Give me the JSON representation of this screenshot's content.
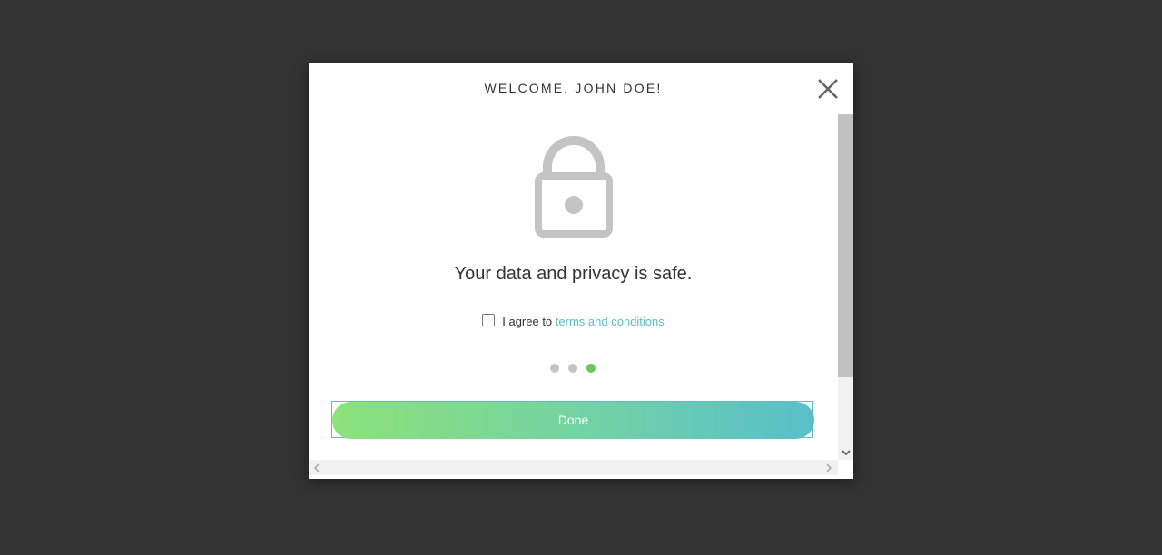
{
  "modal": {
    "title": "WELCOME, JOHN DOE!",
    "close_icon": "close-icon",
    "hero_icon": "lock-icon",
    "message": "Your data and privacy is safe.",
    "agreement": {
      "checked": false,
      "prefix": "I agree to",
      "link_text": "terms and conditions"
    },
    "pagination": {
      "total": 3,
      "active_index": 2
    },
    "done_label": "Done"
  },
  "colors": {
    "backdrop": "#333333",
    "accent_green": "#6cc75a",
    "link": "#5bbcc8",
    "button_gradient_start": "#8de27a",
    "button_gradient_end": "#59bfcb",
    "icon_gray": "#c4c4c4"
  }
}
